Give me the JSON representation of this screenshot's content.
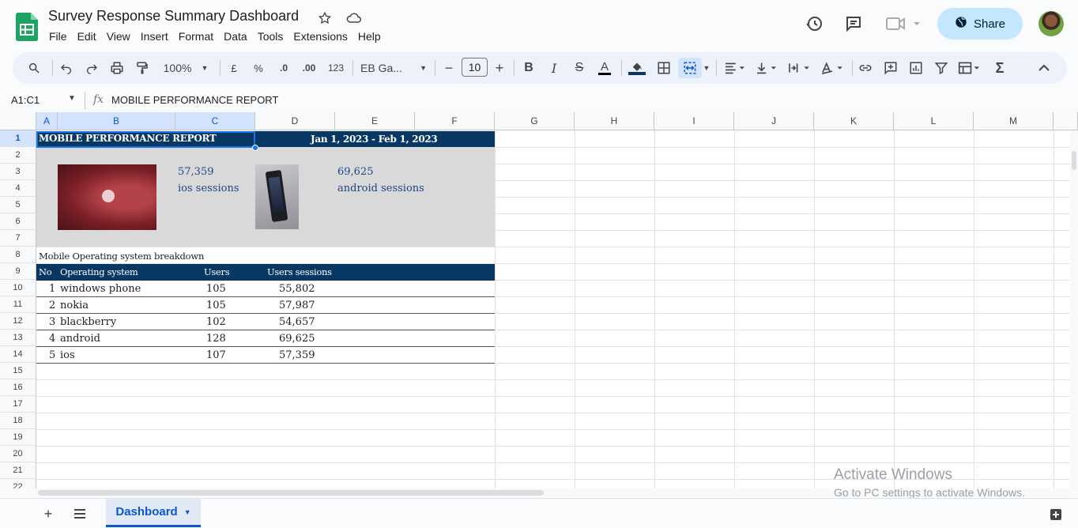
{
  "document": {
    "title": "Survey Response Summary Dashboard"
  },
  "menu": [
    "File",
    "Edit",
    "View",
    "Insert",
    "Format",
    "Data",
    "Tools",
    "Extensions",
    "Help"
  ],
  "header": {
    "share_label": "Share"
  },
  "toolbar": {
    "zoom": "100%",
    "currency": "£",
    "percent": "%",
    "decrease_decimals": ".0",
    "increase_decimals": ".00",
    "number_format": "123",
    "font": "EB Ga...",
    "font_size": "10"
  },
  "formula_bar": {
    "name_box": "A1:C1",
    "content": "MOBILE PERFORMANCE REPORT"
  },
  "columns": [
    "A",
    "B",
    "C",
    "D",
    "E",
    "F",
    "G",
    "H",
    "I",
    "J",
    "K",
    "L",
    "M"
  ],
  "rows": [
    "1",
    "2",
    "3",
    "4",
    "5",
    "6",
    "7",
    "8",
    "9",
    "10",
    "11",
    "12",
    "13",
    "14",
    "15",
    "16",
    "17",
    "18",
    "19",
    "20",
    "21",
    "22"
  ],
  "report": {
    "title": "MOBILE PERFORMANCE REPORT",
    "date_range": "Jan 1, 2023 -  Feb 1, 2023",
    "ios_value": "57,359",
    "ios_label": "ios sessions",
    "android_value": "69,625",
    "android_label": "android sessions",
    "breakdown_title": "Mobile Operating system breakdown",
    "table_headers": [
      "No",
      "Operating system",
      "Users",
      "Users sessions"
    ],
    "table_rows": [
      [
        "1",
        "windows phone",
        "105",
        "55,802"
      ],
      [
        "2",
        "nokia",
        "105",
        "57,987"
      ],
      [
        "3",
        "blackberry",
        "102",
        "54,657"
      ],
      [
        "4",
        "android",
        "128",
        "69,625"
      ],
      [
        "5",
        "ios",
        "107",
        "57,359"
      ]
    ]
  },
  "sheet_tabs": [
    "Dashboard"
  ],
  "watermark": {
    "line1": "Activate Windows",
    "line2": "Go to PC settings to activate Windows."
  },
  "colors": {
    "band": "#073763",
    "gray_panel": "#d9d9d9",
    "accent": "#0b57d0",
    "share_bg": "#c2e7ff"
  }
}
